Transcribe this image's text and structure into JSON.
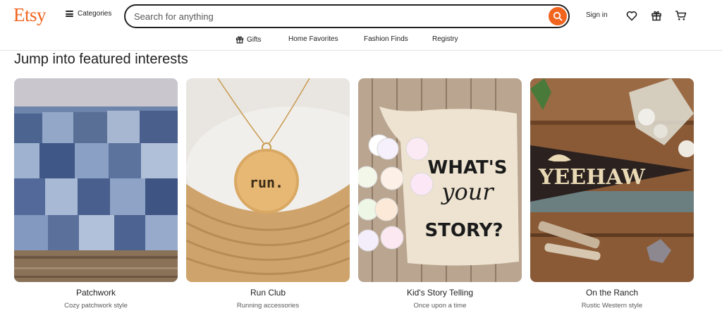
{
  "header": {
    "logo": "Etsy",
    "categories_label": "Categories",
    "search_placeholder": "Search for anything",
    "signin_label": "Sign in",
    "icons": [
      "hamburger-icon",
      "search-icon",
      "heart-icon",
      "gift-icon",
      "cart-icon"
    ]
  },
  "nav": {
    "items": [
      {
        "label": "Gifts",
        "icon": "gift-icon"
      },
      {
        "label": "Home Favorites"
      },
      {
        "label": "Fashion Finds"
      },
      {
        "label": "Registry"
      }
    ]
  },
  "section": {
    "title": "Jump into featured interests",
    "cards": [
      {
        "title": "Patchwork",
        "subtitle": "Cozy patchwork style"
      },
      {
        "title": "Run Club",
        "subtitle": "Running accessories",
        "image_text": "run."
      },
      {
        "title": "Kid's Story Telling",
        "subtitle": "Once upon a time",
        "image_text": [
          "WHAT'S",
          "your",
          "STORY?"
        ]
      },
      {
        "title": "On the Ranch",
        "subtitle": "Rustic Western style",
        "image_text": "YEEHAW"
      }
    ]
  },
  "colors": {
    "brand": "#f1641e",
    "text": "#222222",
    "muted": "#595959",
    "divider": "#e1e3df"
  }
}
